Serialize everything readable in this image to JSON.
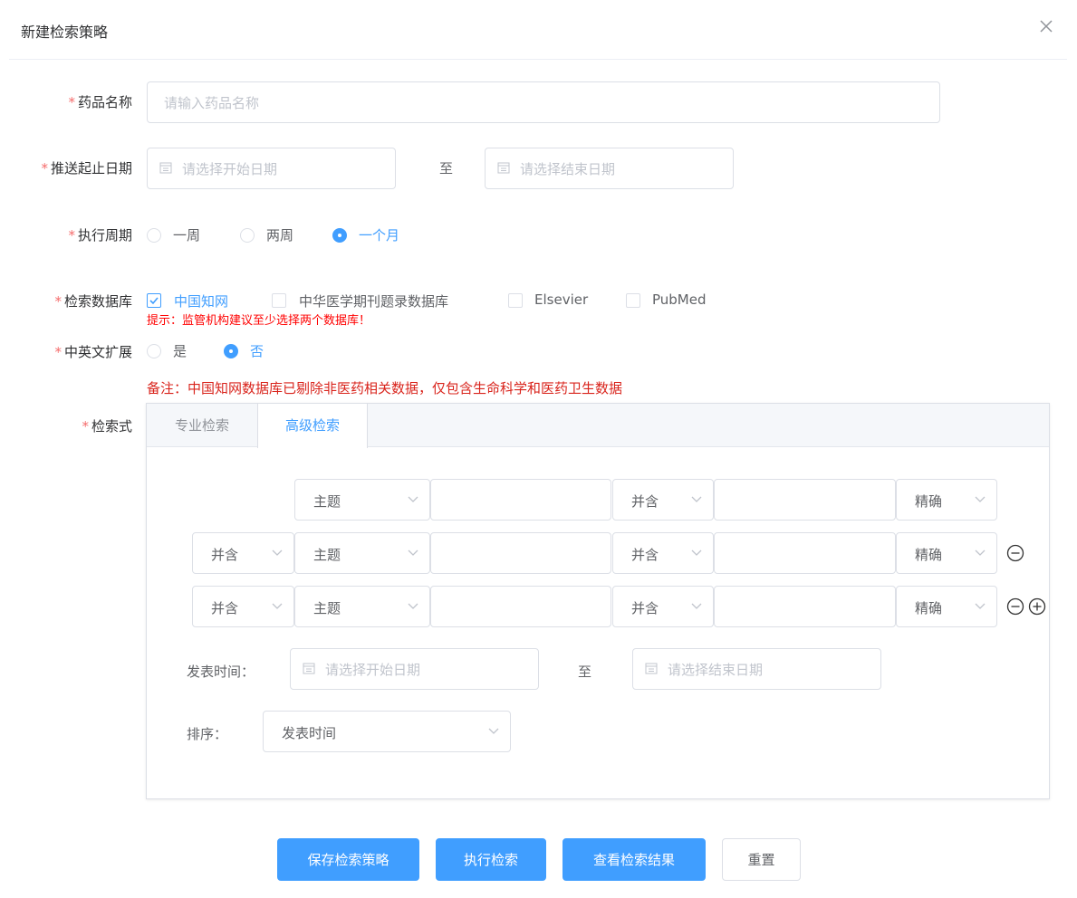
{
  "dialog": {
    "title": "新建检索策略",
    "close_icon": "close-icon"
  },
  "fields": {
    "drug": {
      "required": "*",
      "label": "药品名称",
      "placeholder": "请输入药品名称"
    },
    "push_dates": {
      "required": "*",
      "label": "推送起止日期",
      "start_placeholder": "请选择开始日期",
      "separator": "至",
      "end_placeholder": "请选择结束日期"
    },
    "cycle": {
      "required": "*",
      "label": "执行周期",
      "options": [
        "一周",
        "两周",
        "一个月"
      ],
      "selected": "一个月"
    },
    "databases": {
      "required": "*",
      "label": "检索数据库",
      "options": [
        "中国知网",
        "中华医学期刊题录数据库",
        "Elsevier",
        "PubMed"
      ],
      "checked": [
        "中国知网"
      ],
      "hint": "提示：监管机构建议至少选择两个数据库！"
    },
    "expansion": {
      "required": "*",
      "label": "中英文扩展",
      "options": [
        "是",
        "否"
      ],
      "selected": "否"
    },
    "note": "备注：中国知网数据库已剔除非医药相关数据，仅包含生命科学和医药卫生数据",
    "query": {
      "required": "*",
      "label": "检索式"
    }
  },
  "query_panel": {
    "tabs": [
      "专业检索",
      "高级检索"
    ],
    "active_tab": "高级检索",
    "rows": [
      {
        "logic": null,
        "field": "主题",
        "value": "",
        "op": "并含",
        "value2": "",
        "match": "精确"
      },
      {
        "logic": "并含",
        "field": "主题",
        "value": "",
        "op": "并含",
        "value2": "",
        "match": "精确"
      },
      {
        "logic": "并含",
        "field": "主题",
        "value": "",
        "op": "并含",
        "value2": "",
        "match": "精确"
      }
    ],
    "pub_time": {
      "label": "发表时间：",
      "start_placeholder": "请选择开始日期",
      "separator": "至",
      "end_placeholder": "请选择结束日期"
    },
    "sort": {
      "label": "排序：",
      "value": "发表时间"
    }
  },
  "buttons": {
    "save": "保存检索策略",
    "execute": "执行检索",
    "view": "查看检索结果",
    "reset": "重置"
  },
  "colors": {
    "primary": "#409eff",
    "required": "#f56c6c",
    "hint": "#ff0000",
    "note": "#d9241c",
    "border": "#dcdfe6"
  }
}
